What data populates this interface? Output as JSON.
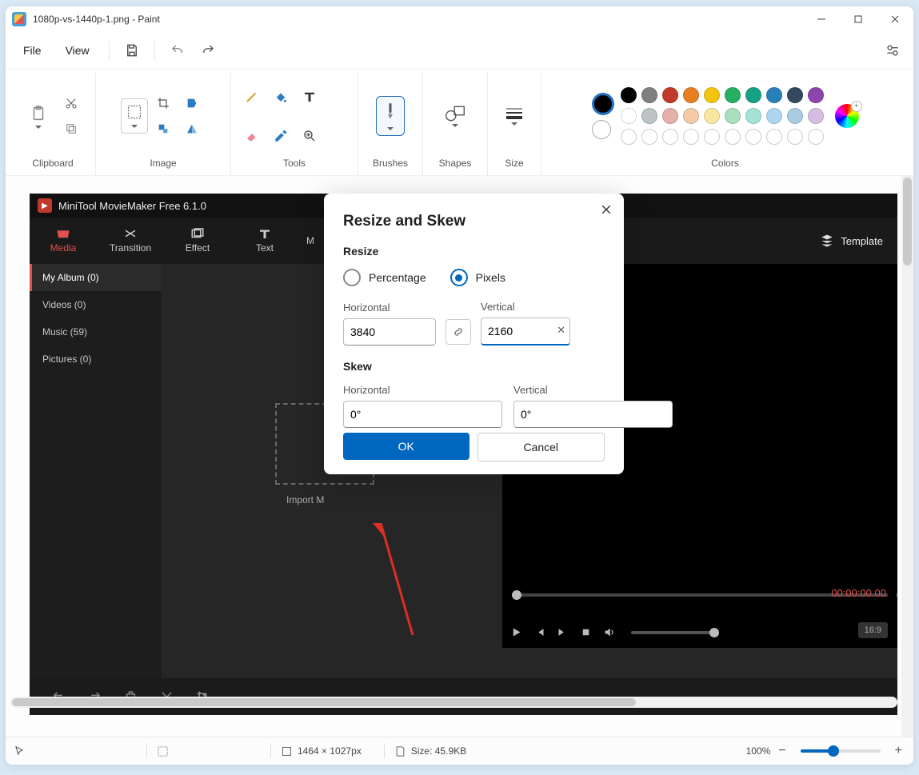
{
  "title": "1080p-vs-1440p-1.png - Paint",
  "menus": {
    "file": "File",
    "view": "View"
  },
  "ribbon": {
    "clipboard": "Clipboard",
    "image": "Image",
    "tools": "Tools",
    "brushes": "Brushes",
    "shapes": "Shapes",
    "size": "Size",
    "colors": "Colors"
  },
  "palette_row1": [
    "#000000",
    "#7f7f7f",
    "#c0392b",
    "#e67e22",
    "#f1c40f",
    "#27ae60",
    "#16a085",
    "#2980b9",
    "#34495e",
    "#8e44ad"
  ],
  "palette_row2": [
    "#ffffff",
    "#bdc3c7",
    "#e6b0aa",
    "#f5cba7",
    "#f9e79f",
    "#a9dfbf",
    "#a3e4d7",
    "#aed6f1",
    "#a9cce3",
    "#d7bde2"
  ],
  "embedded": {
    "title": "MiniTool MovieMaker Free 6.1.0",
    "tabs": [
      "Media",
      "Transition",
      "Effect",
      "Text",
      "M"
    ],
    "template": "Template",
    "side": [
      "My Album (0)",
      "Videos (0)",
      "Music (59)",
      "Pictures (0)"
    ],
    "import": "Import M",
    "timecode": "00:00:00.00",
    "sep": "/",
    "ratio": "16:9"
  },
  "dialog": {
    "title": "Resize and Skew",
    "resize": "Resize",
    "percentage": "Percentage",
    "pixels": "Pixels",
    "horizontal": "Horizontal",
    "vertical": "Vertical",
    "hval": "3840",
    "vval": "2160",
    "skew": "Skew",
    "skewh": "0°",
    "skewv": "0°",
    "ok": "OK",
    "cancel": "Cancel"
  },
  "status": {
    "dims": "1464 × 1027px",
    "size": "Size: 45.9KB",
    "zoom": "100%"
  }
}
